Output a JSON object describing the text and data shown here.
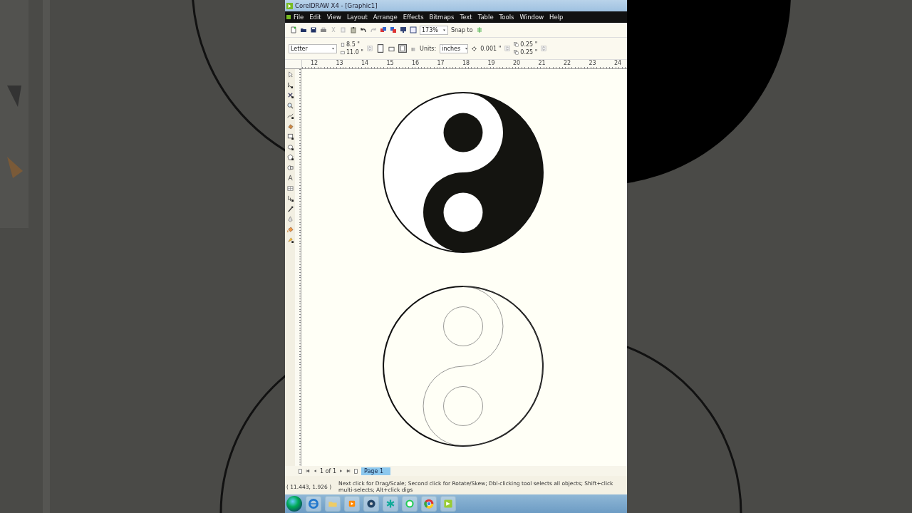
{
  "window": {
    "title": "CorelDRAW X4 - [Graphic1]"
  },
  "menu": [
    "File",
    "Edit",
    "View",
    "Layout",
    "Arrange",
    "Effects",
    "Bitmaps",
    "Text",
    "Table",
    "Tools",
    "Window",
    "Help"
  ],
  "toolbar": {
    "zoom": "173%",
    "snap": "Snap to"
  },
  "property_bar": {
    "paper": "Letter",
    "width": "8.5 \"",
    "height": "11.0 \"",
    "units_label": "Units:",
    "units": "inches",
    "nudge": "0.001 \"",
    "dup_x": "0.25 \"",
    "dup_y": "0.25 \""
  },
  "ruler": [
    "12",
    "13",
    "14",
    "15",
    "16",
    "17",
    "18",
    "19",
    "20",
    "21",
    "22",
    "23",
    "24"
  ],
  "drawings": [
    {
      "kind": "filled"
    },
    {
      "kind": "outline"
    }
  ],
  "page_nav": {
    "count": "1 of 1",
    "tabs": [
      {
        "label": "Page 1",
        "selected": true
      }
    ]
  },
  "status": {
    "coords": "( 11.443, 1.926 )",
    "hint": "Next click for Drag/Scale; Second click for Rotate/Skew; Dbl-clicking tool selects all objects; Shift+click multi-selects; Alt+click digs"
  }
}
